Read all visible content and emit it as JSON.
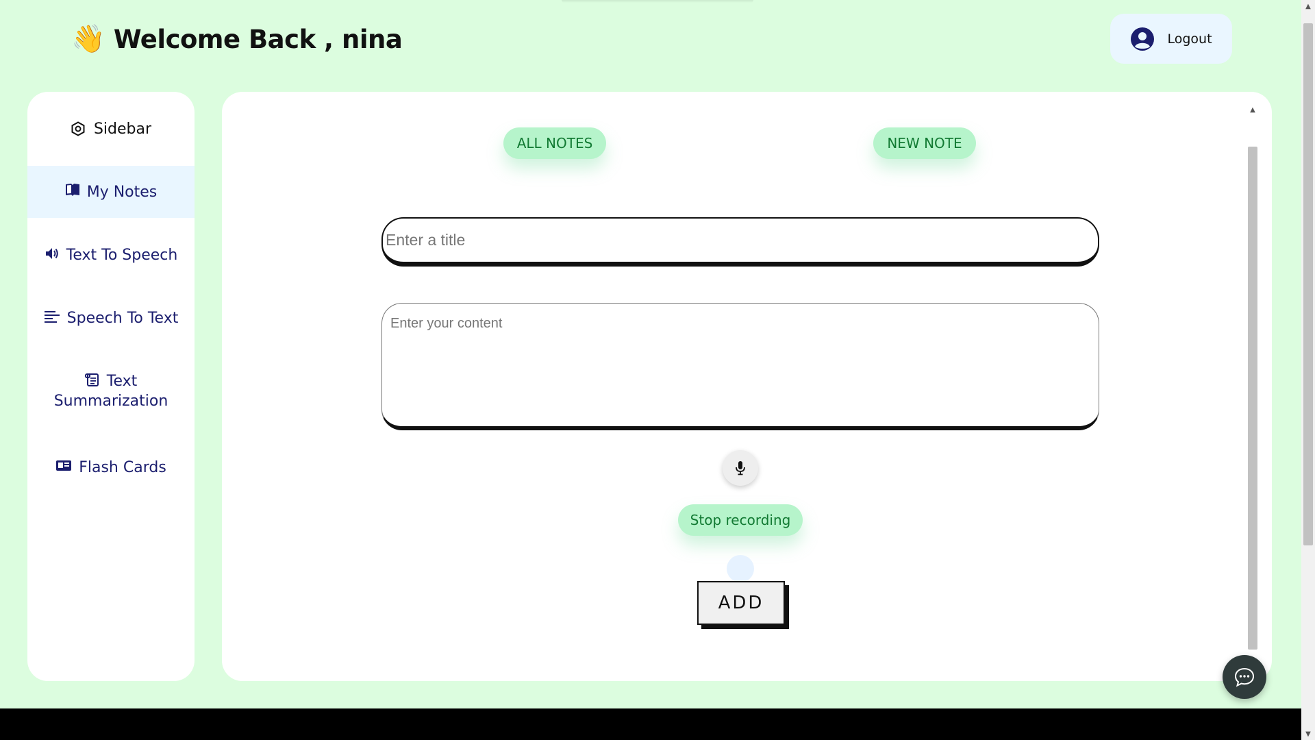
{
  "header": {
    "wave_emoji": "👋",
    "welcome_text": "Welcome Back , nina",
    "logout_label": "Logout"
  },
  "sidebar": {
    "title": "Sidebar",
    "items": [
      {
        "label": "My Notes",
        "icon": "book-icon",
        "active": true
      },
      {
        "label": "Text To Speech",
        "icon": "speaker-icon"
      },
      {
        "label": "Speech To Text",
        "icon": "text-lines-icon"
      },
      {
        "label_line1": "Text",
        "label_line2": "Summarization",
        "icon": "scroll-icon"
      },
      {
        "label": "Flash Cards",
        "icon": "card-icon"
      }
    ]
  },
  "main": {
    "all_notes_label": "ALL NOTES",
    "new_note_label": "NEW NOTE",
    "title_placeholder": "Enter a title",
    "content_placeholder": "Enter your content",
    "stop_recording_label": "Stop recording",
    "add_label": "ADD"
  },
  "colors": {
    "page_bg": "#dcfddf",
    "pill_bg": "#b6f4cb",
    "pill_text": "#127a33",
    "nav_text": "#1b1e6e",
    "active_item_bg": "#e9f6ff"
  }
}
